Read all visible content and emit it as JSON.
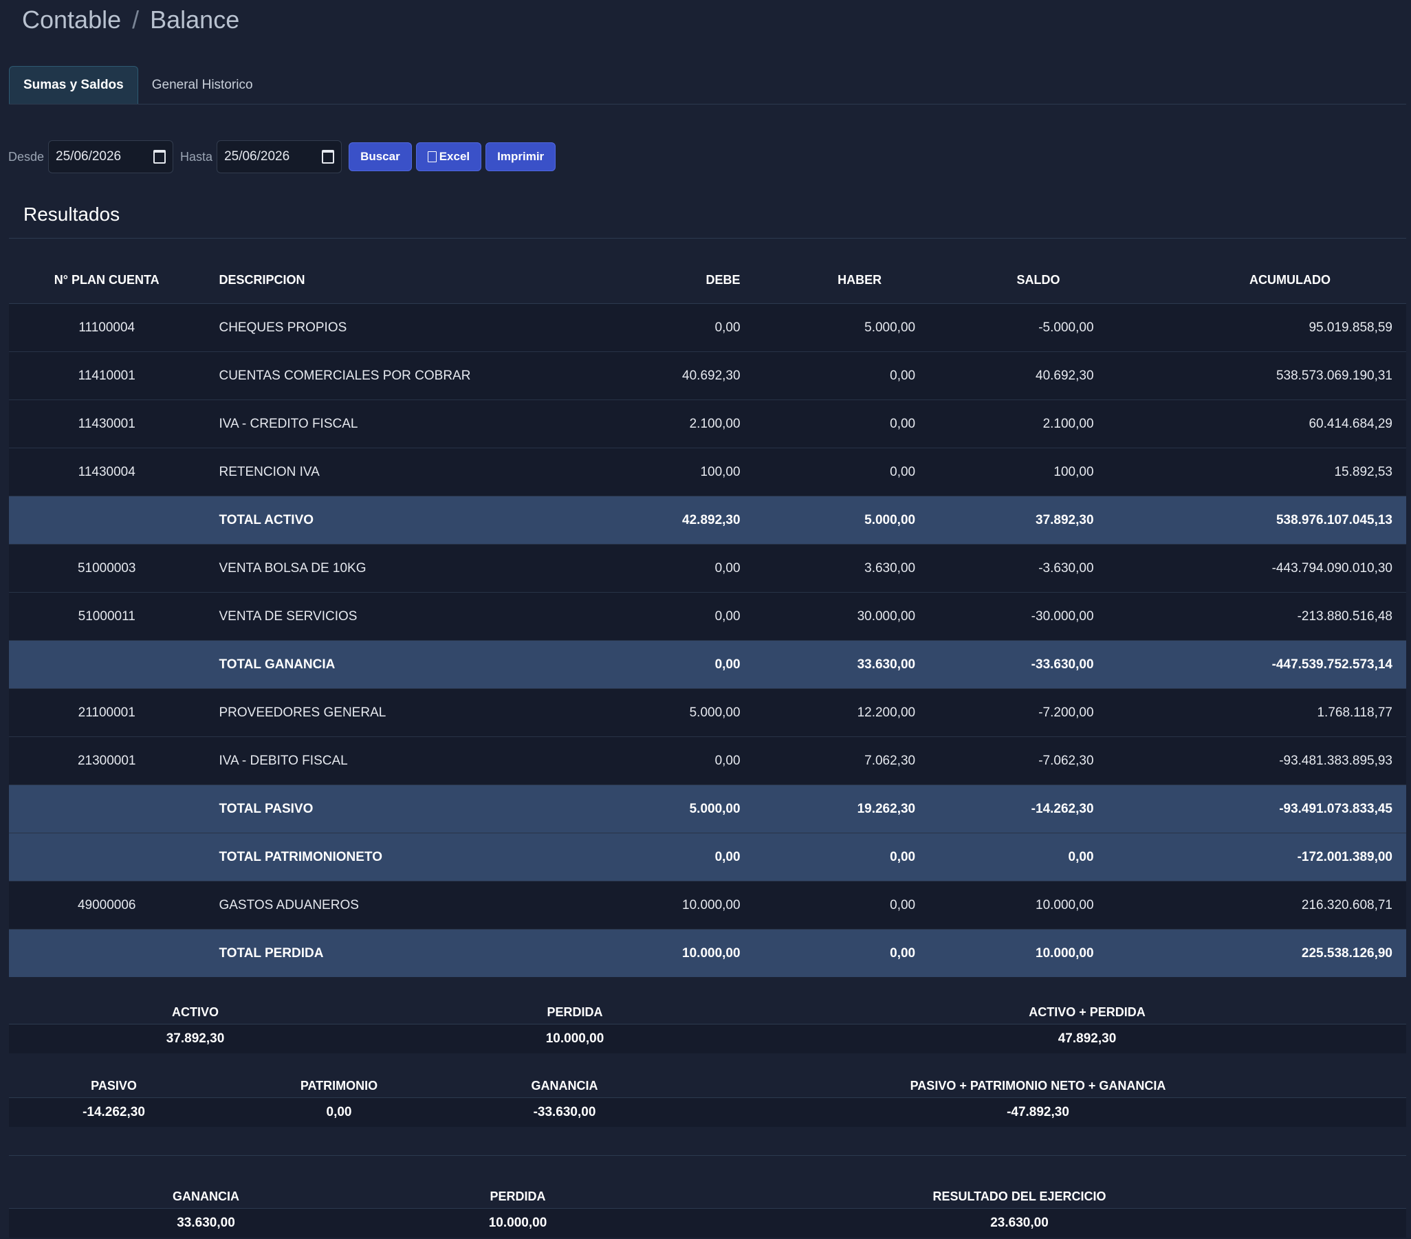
{
  "breadcrumb": {
    "part1": "Contable",
    "separator": "/",
    "part2": "Balance"
  },
  "tabs": [
    {
      "label": "Sumas y Saldos"
    },
    {
      "label": "General Historico"
    }
  ],
  "filters": {
    "desde_label": "Desde",
    "desde_value": "25/06/2026",
    "hasta_label": "Hasta",
    "hasta_value": "25/06/2026",
    "buscar": "Buscar",
    "excel": "Excel",
    "imprimir": "Imprimir"
  },
  "section_title": "Resultados",
  "table": {
    "headers": {
      "code": "N° PLAN CUENTA",
      "desc": "DESCRIPCION",
      "debe": "DEBE",
      "haber": "HABER",
      "saldo": "SALDO",
      "acumulado": "ACUMULADO"
    },
    "rows": [
      {
        "code": "11100004",
        "desc": "CHEQUES PROPIOS",
        "debe": "0,00",
        "haber": "5.000,00",
        "saldo": "-5.000,00",
        "acumulado": "95.019.858,59",
        "total": false
      },
      {
        "code": "11410001",
        "desc": "CUENTAS COMERCIALES POR COBRAR",
        "debe": "40.692,30",
        "haber": "0,00",
        "saldo": "40.692,30",
        "acumulado": "538.573.069.190,31",
        "total": false
      },
      {
        "code": "11430001",
        "desc": "IVA - CREDITO FISCAL",
        "debe": "2.100,00",
        "haber": "0,00",
        "saldo": "2.100,00",
        "acumulado": "60.414.684,29",
        "total": false
      },
      {
        "code": "11430004",
        "desc": "RETENCION IVA",
        "debe": "100,00",
        "haber": "0,00",
        "saldo": "100,00",
        "acumulado": "15.892,53",
        "total": false
      },
      {
        "code": "",
        "desc": "TOTAL ACTIVO",
        "debe": "42.892,30",
        "haber": "5.000,00",
        "saldo": "37.892,30",
        "acumulado": "538.976.107.045,13",
        "total": true
      },
      {
        "code": "51000003",
        "desc": "VENTA BOLSA DE 10KG",
        "debe": "0,00",
        "haber": "3.630,00",
        "saldo": "-3.630,00",
        "acumulado": "-443.794.090.010,30",
        "total": false
      },
      {
        "code": "51000011",
        "desc": "VENTA DE SERVICIOS",
        "debe": "0,00",
        "haber": "30.000,00",
        "saldo": "-30.000,00",
        "acumulado": "-213.880.516,48",
        "total": false
      },
      {
        "code": "",
        "desc": "TOTAL GANANCIA",
        "debe": "0,00",
        "haber": "33.630,00",
        "saldo": "-33.630,00",
        "acumulado": "-447.539.752.573,14",
        "total": true
      },
      {
        "code": "21100001",
        "desc": "PROVEEDORES GENERAL",
        "debe": "5.000,00",
        "haber": "12.200,00",
        "saldo": "-7.200,00",
        "acumulado": "1.768.118,77",
        "total": false
      },
      {
        "code": "21300001",
        "desc": "IVA - DEBITO FISCAL",
        "debe": "0,00",
        "haber": "7.062,30",
        "saldo": "-7.062,30",
        "acumulado": "-93.481.383.895,93",
        "total": false
      },
      {
        "code": "",
        "desc": "TOTAL PASIVO",
        "debe": "5.000,00",
        "haber": "19.262,30",
        "saldo": "-14.262,30",
        "acumulado": "-93.491.073.833,45",
        "total": true
      },
      {
        "code": "",
        "desc": "TOTAL PATRIMONIONETO",
        "debe": "0,00",
        "haber": "0,00",
        "saldo": "0,00",
        "acumulado": "-172.001.389,00",
        "total": true
      },
      {
        "code": "49000006",
        "desc": "GASTOS ADUANEROS",
        "debe": "10.000,00",
        "haber": "0,00",
        "saldo": "10.000,00",
        "acumulado": "216.320.608,71",
        "total": false
      },
      {
        "code": "",
        "desc": "TOTAL PERDIDA",
        "debe": "10.000,00",
        "haber": "0,00",
        "saldo": "10.000,00",
        "acumulado": "225.538.126,90",
        "total": true
      }
    ]
  },
  "summary1": {
    "activo_label": "ACTIVO",
    "activo_value": "37.892,30",
    "perdida_label": "PERDIDA",
    "perdida_value": "10.000,00",
    "sum_label": "ACTIVO + PERDIDA",
    "sum_value": "47.892,30"
  },
  "summary2": {
    "pasivo_label": "PASIVO",
    "pasivo_value": "-14.262,30",
    "patrimonio_label": "PATRIMONIO",
    "patrimonio_value": "0,00",
    "ganancia_label": "GANANCIA",
    "ganancia_value": "-33.630,00",
    "sum_label": "PASIVO + PATRIMONIO NETO + GANANCIA",
    "sum_value": "-47.892,30"
  },
  "summary3": {
    "ganancia_label": "GANANCIA",
    "ganancia_value": "33.630,00",
    "perdida_label": "PERDIDA",
    "perdida_value": "10.000,00",
    "resultado_label": "RESULTADO DEL EJERCICIO",
    "resultado_value": "23.630,00"
  }
}
